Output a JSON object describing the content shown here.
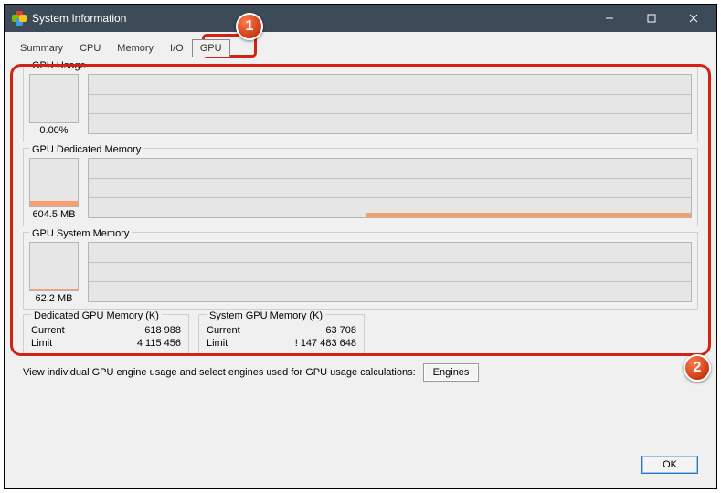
{
  "window": {
    "title": "System Information"
  },
  "tabs": [
    "Summary",
    "CPU",
    "Memory",
    "I/O",
    "GPU"
  ],
  "active_tab": "GPU",
  "groups": {
    "usage": {
      "title": "GPU Usage",
      "value": "0.00%",
      "fill_pct": 0
    },
    "dedicated": {
      "title": "GPU Dedicated Memory",
      "value": "604.5 MB",
      "fill_pct": 12
    },
    "system": {
      "title": "GPU System Memory",
      "value": "62.2 MB",
      "fill_pct": 2
    }
  },
  "stats": {
    "dedicated": {
      "title": "Dedicated GPU Memory (K)",
      "current_label": "Current",
      "current": "618 988",
      "limit_label": "Limit",
      "limit": "4 115 456"
    },
    "system": {
      "title": "System GPU Memory (K)",
      "current_label": "Current",
      "current": "63 708",
      "limit_label": "Limit",
      "limit": "! 147 483 648"
    }
  },
  "engines_text": "View individual GPU engine usage and select engines used for GPU usage calculations:",
  "buttons": {
    "engines": "Engines",
    "ok": "OK"
  },
  "badges": {
    "one": "1",
    "two": "2"
  }
}
